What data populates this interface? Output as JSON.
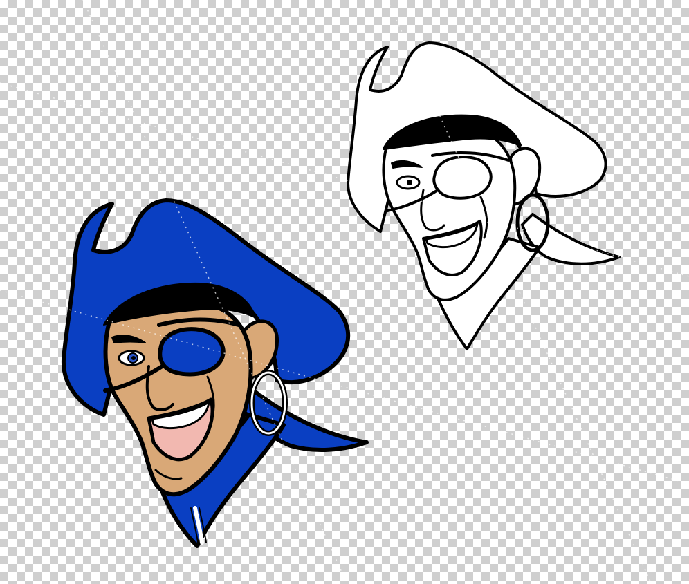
{
  "artwork": {
    "subject": "pirate-mascot-head",
    "variants": [
      "color",
      "outline"
    ]
  },
  "colors": {
    "hat": "#0a3fc2",
    "skin": "#d9a877",
    "outline": "#000000",
    "eye_iris": "#2a55c9",
    "mouth": "#f2b8b0",
    "teeth": "#ffffff",
    "background_checker_light": "#ffffff",
    "background_checker_dark": "#cfcfcf"
  }
}
